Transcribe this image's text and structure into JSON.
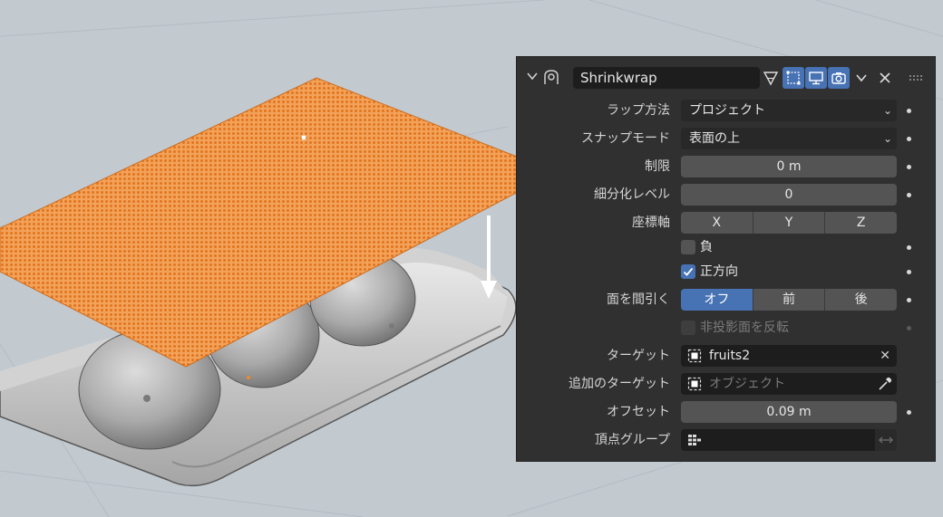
{
  "modifier": {
    "name": "Shrinkwrap"
  },
  "labels": {
    "wrap_method": "ラップ方法",
    "snap_mode": "スナップモード",
    "limit": "制限",
    "subdiv_levels": "細分化レベル",
    "axis": "座標軸",
    "cull_faces": "面を間引く",
    "target": "ターゲット",
    "aux_target": "追加のターゲット",
    "offset": "オフセット",
    "vertex_group": "頂点グループ"
  },
  "values": {
    "wrap_method": "プロジェクト",
    "snap_mode": "表面の上",
    "limit": "0 m",
    "subdiv_levels": "0",
    "target": "fruits2",
    "aux_target_placeholder": "オブジェクト",
    "offset": "0.09 m",
    "vertex_group": ""
  },
  "axis_buttons": [
    "X",
    "Y",
    "Z"
  ],
  "checkboxes": {
    "negative": {
      "label": "負",
      "checked": false
    },
    "positive": {
      "label": "正方向",
      "checked": true
    },
    "invert_cull": {
      "label": "非投影面を反転",
      "checked": false
    }
  },
  "cull_buttons": [
    "オフ",
    "前",
    "後"
  ],
  "cull_active": "オフ",
  "colors": {
    "accent": "#4772b3",
    "panel": "#303030",
    "mesh": "#f08a2c",
    "viewport_bg": "#c2c9cf"
  }
}
